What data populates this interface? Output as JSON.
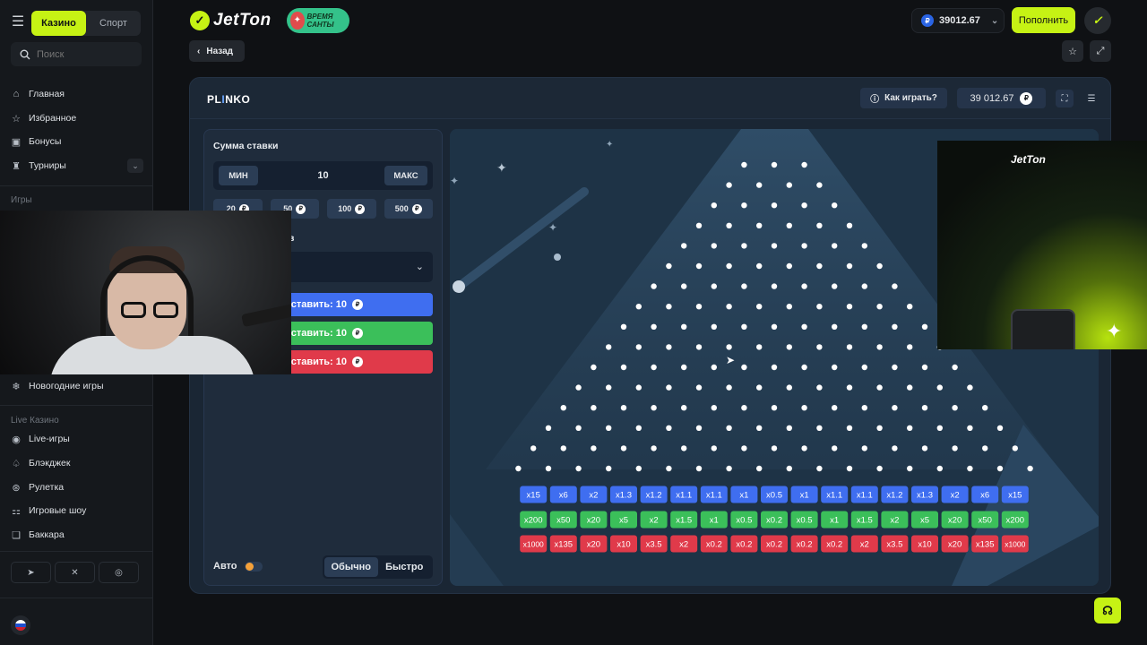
{
  "sidebar": {
    "tabs": [
      {
        "label": "Казино",
        "active": true
      },
      {
        "label": "Спорт",
        "active": false
      }
    ],
    "search": {
      "placeholder": "Поиск"
    },
    "main_items": [
      {
        "label": "Главная",
        "icon": "home-icon"
      },
      {
        "label": "Избранное",
        "icon": "star-icon"
      },
      {
        "label": "Бонусы",
        "icon": "gift-icon"
      },
      {
        "label": "Турниры",
        "icon": "trophy-icon"
      }
    ],
    "games_title": "Игры",
    "new_year_item": {
      "label": "Новогодние игры",
      "icon": "snowflake-icon"
    },
    "live_title": "Live Казино",
    "live_items": [
      {
        "label": "Live-игры",
        "icon": "live-icon"
      },
      {
        "label": "Блэкджек",
        "icon": "spade-icon"
      },
      {
        "label": "Рулетка",
        "icon": "roulette-icon"
      },
      {
        "label": "Игровые шоу",
        "icon": "show-icon"
      },
      {
        "label": "Баккара",
        "icon": "baccarat-icon"
      }
    ],
    "socials": [
      "telegram-icon",
      "x-icon",
      "instagram-icon"
    ]
  },
  "header": {
    "logo": "JetTon",
    "promo_badge": "ВРЕМЯ САНТЫ",
    "balance": "39012.67",
    "currency_symbol": "₽",
    "deposit_label": "Пополнить",
    "back_label": "Назад"
  },
  "game": {
    "name_prefix": "PL",
    "name_accent": "I",
    "name_suffix": "NKO",
    "how_to_play": "Как играть?",
    "balance": "39 012.67",
    "panel": {
      "stake_label": "Сумма ставки",
      "min_label": "МИН",
      "max_label": "МАКС",
      "stake_value": "10",
      "chips": [
        "20",
        "50",
        "100",
        "500"
      ],
      "risk_label_visible": "в",
      "play_buttons": [
        {
          "label": "Поставить: 10",
          "color": "#3f6ef0"
        },
        {
          "label": "Поставить: 10",
          "color": "#3bbf5a"
        },
        {
          "label": "Поставить: 10",
          "color": "#e03a4a"
        }
      ],
      "auto_label": "Авто",
      "speed_options": [
        {
          "label": "Обычно",
          "active": true
        },
        {
          "label": "Быстро",
          "active": false
        }
      ]
    },
    "multipliers": {
      "blue": [
        "x15",
        "x6",
        "x2",
        "x1.3",
        "x1.2",
        "x1.1",
        "x1.1",
        "x1",
        "x0.5",
        "x1",
        "x1.1",
        "x1.1",
        "x1.2",
        "x1.3",
        "x2",
        "x6",
        "x15"
      ],
      "green": [
        "x200",
        "x50",
        "x20",
        "x5",
        "x2",
        "x1.5",
        "x1",
        "x0.5",
        "x0.2",
        "x0.5",
        "x1",
        "x1.5",
        "x2",
        "x5",
        "x20",
        "x50",
        "x200"
      ],
      "red": [
        "x1000",
        "x135",
        "x20",
        "x10",
        "x3.5",
        "x2",
        "x0.2",
        "x0.2",
        "x0.2",
        "x0.2",
        "x0.2",
        "x2",
        "x3.5",
        "x10",
        "x20",
        "x135",
        "x1000"
      ]
    },
    "colors": {
      "blue": "#3f6ef0",
      "green": "#3bbf5a",
      "red": "#e03a4a"
    }
  },
  "overlay": {
    "promo_logo": "JetTon"
  }
}
